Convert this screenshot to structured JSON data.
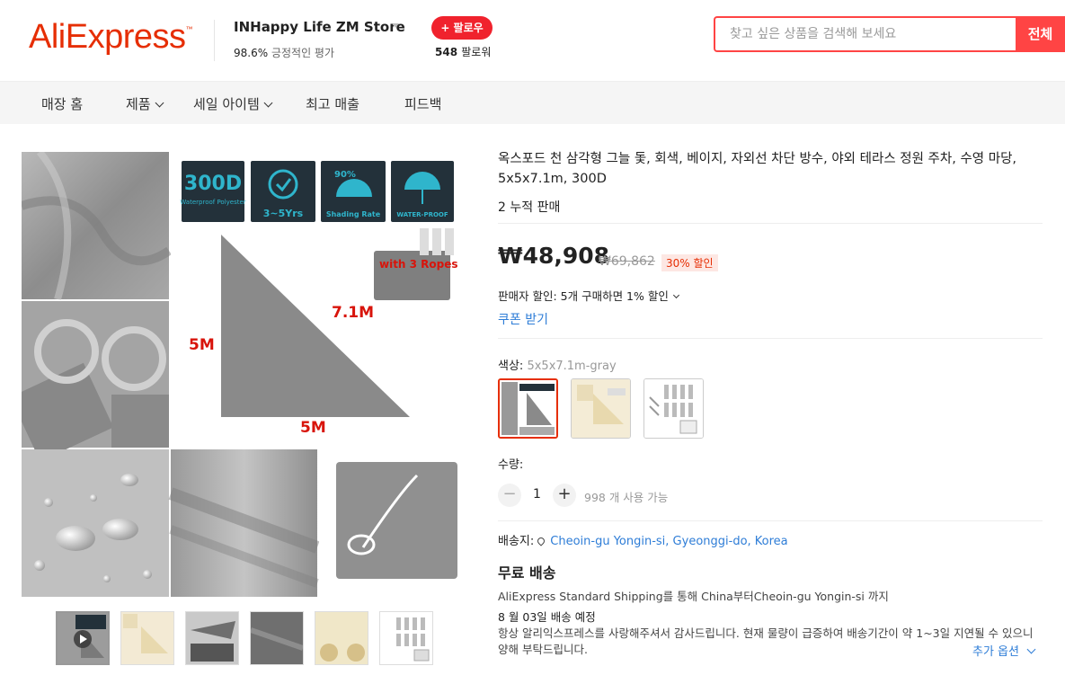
{
  "header": {
    "logo": "AliExpress",
    "store_name": "INHappy Life ZM Store",
    "rating_value": "98.6%",
    "rating_text": "긍정적인 평가",
    "follow_label": "+ 팔로우",
    "followers_count": "548",
    "followers_label": "팔로워",
    "search_placeholder": "찾고 싶은 상품을 검색해 보세요",
    "search_button": "전체"
  },
  "nav": {
    "items": [
      {
        "label": "매장 홈"
      },
      {
        "label": "제품"
      },
      {
        "label": "세일 아이템"
      },
      {
        "label": "최고 매출"
      },
      {
        "label": "피드백"
      }
    ]
  },
  "gallery": {
    "main": {
      "badge_300d": "300D",
      "badge_waterproof_polyester": "Waterproof Polyester",
      "badge_years": "3~5Yrs",
      "badge_90": "90%",
      "badge_shading": "Shading Rate",
      "badge_waterproof": "WATER-PROOF",
      "ropes_text": "with 3 Ropes",
      "dim_hyp": "7.1M",
      "dim_left": "5M",
      "dim_bottom": "5M"
    },
    "thumb_count": 6
  },
  "product": {
    "title": "옥스포드 천 삼각형 그늘 돛, 회색, 베이지, 자외선 차단 방수, 야외 테라스 정원 주차, 수영 마당, 5x5x7.1m, 300D",
    "sold": "2 누적 판매",
    "price": "₩48,908",
    "original_price": "₩69,862",
    "discount": "30% 할인",
    "seller_discount": "판매자 할인: 5개 구매하면 1% 할인",
    "coupon": "쿠폰 받기",
    "color_label": "색상:",
    "color_value": "5x5x7.1m-gray",
    "quantity_label": "수량:",
    "quantity_minus": "−",
    "quantity_value": "1",
    "quantity_plus": "+",
    "quantity_available": "998 개 사용 가능",
    "ship_to_label": "배송지:",
    "ship_to_location": "Cheoin-gu Yongin-si, Gyeonggi-do, Korea",
    "free_shipping": "무료 배송",
    "shipping_method": "AliExpress Standard Shipping를 통해 China부터Cheoin-gu Yongin-si 까지",
    "delivery_date": "8 월 03일 배송 예정",
    "shipping_note": "항상 알리익스프레스를 사랑해주셔서 감사드립니다. 현재 물량이 급증하여 배송기간이 약 1~3일 지연될 수 있으니 양해 부탁드립니다.",
    "more_options": "추가 옵션"
  },
  "colors": {
    "brand": "#e62e04",
    "accent_red": "#f44444",
    "link_blue": "#2e7dd7",
    "fabric_gray": "#8a8a8a",
    "badge_dark": "#23313a",
    "badge_cyan": "#2fb5cc"
  }
}
